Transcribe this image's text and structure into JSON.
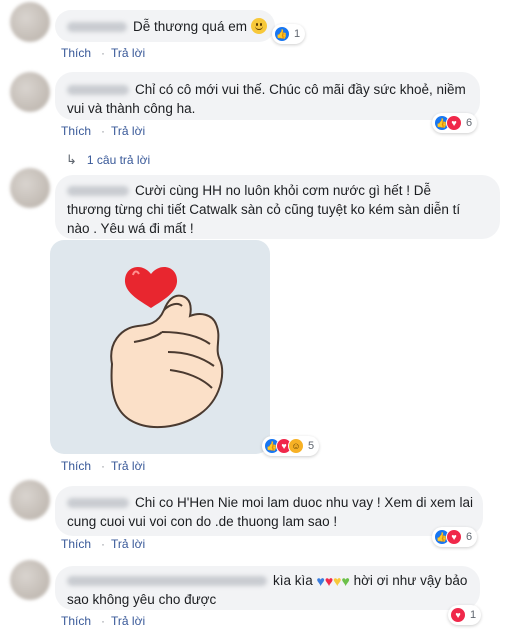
{
  "actions": {
    "like": "Thích",
    "reply": "Trả lời",
    "separator": "·"
  },
  "comments": [
    {
      "text": "Dễ thương quá em",
      "reactions": {
        "types": [
          "like"
        ],
        "count": "1"
      }
    },
    {
      "text": "Chỉ có cô mới vui thế. Chúc cô mãi đầy sức khoẻ, niềm vui và thành công ha.",
      "reactions": {
        "types": [
          "like",
          "love"
        ],
        "count": "6"
      },
      "replies_link": "1 câu trả lời"
    },
    {
      "text": "Cười cùng HH no luôn khỏi cơm nước gì hết ! Dễ thương từng chi tiết Catwalk sàn cỏ cũng tuyệt ko kém sàn diễn tí nào . Yêu wá đi mất !",
      "sticker": "finger-heart-sticker",
      "reactions": {
        "types": [
          "like",
          "love",
          "haha"
        ],
        "count": "5"
      }
    },
    {
      "text": "Chi co H'Hen Nie moi lam duoc nhu vay ! Xem di xem lai cung cuoi vui voi con do .de thuong lam sao !",
      "reactions": {
        "types": [
          "like",
          "love"
        ],
        "count": "6"
      }
    },
    {
      "text_before": "kìa kìa",
      "text_after": "hời ơi như vậy bảo sao không yêu cho được",
      "hearts": [
        "#3b7ddd",
        "#f0284a",
        "#f7c83a",
        "#6cc04a"
      ],
      "reactions": {
        "types": [
          "love"
        ],
        "count": "1"
      }
    }
  ]
}
